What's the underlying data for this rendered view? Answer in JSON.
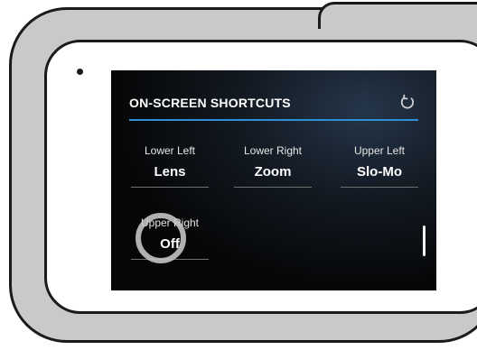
{
  "screen": {
    "title": "ON-SCREEN SHORTCUTS",
    "reset_icon": "reset-rotate-icon",
    "accent_color": "#2f8fd6",
    "shortcuts": [
      {
        "position": "Lower Left",
        "value": "Lens"
      },
      {
        "position": "Lower Right",
        "value": "Zoom"
      },
      {
        "position": "Upper Left",
        "value": "Slo-Mo"
      },
      {
        "position": "Upper Right",
        "value": "Off"
      }
    ]
  }
}
